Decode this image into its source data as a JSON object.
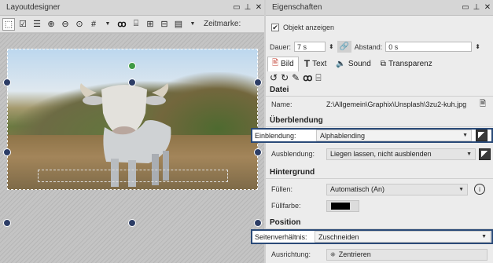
{
  "left_pane": {
    "title": "Layoutdesigner",
    "zeitmarke_label": "Zeitmarke:"
  },
  "right_pane": {
    "title": "Eigenschaften",
    "objekt_anzeigen": "Objekt anzeigen",
    "dauer_label": "Dauer:",
    "dauer_value": "7 s",
    "abstand_label": "Abstand:",
    "abstand_value": "0 s",
    "tabs": [
      {
        "label": "Bild"
      },
      {
        "label": "Text"
      },
      {
        "label": "Sound"
      },
      {
        "label": "Transparenz"
      }
    ],
    "sections": {
      "datei": "Datei",
      "ueberblendung": "Überblendung",
      "hintergrund": "Hintergrund",
      "position": "Position"
    },
    "name_label": "Name:",
    "name_value": "Z:\\Allgemein\\Graphix\\Unsplash\\3zu2-kuh.jpg",
    "einblendung_label": "Einblendung:",
    "einblendung_value": "Alphablending",
    "ausblendung_label": "Ausblendung:",
    "ausblendung_value": "Liegen lassen, nicht ausblenden",
    "fuellen_label": "Füllen:",
    "fuellen_value": "Automatisch (An)",
    "fuellfarbe_label": "Füllfarbe:",
    "fuellfarbe_color": "#000000",
    "seitenverhaeltnis_label": "Seitenverhältnis:",
    "seitenverhaeltnis_value": "Zuschneiden",
    "ausrichtung_label": "Ausrichtung:",
    "ausrichtung_value": "Zentrieren"
  },
  "colors": {
    "highlight_border": "#2a4a78",
    "handle": "#2c3d66",
    "rotation_handle": "#3f9a45"
  }
}
